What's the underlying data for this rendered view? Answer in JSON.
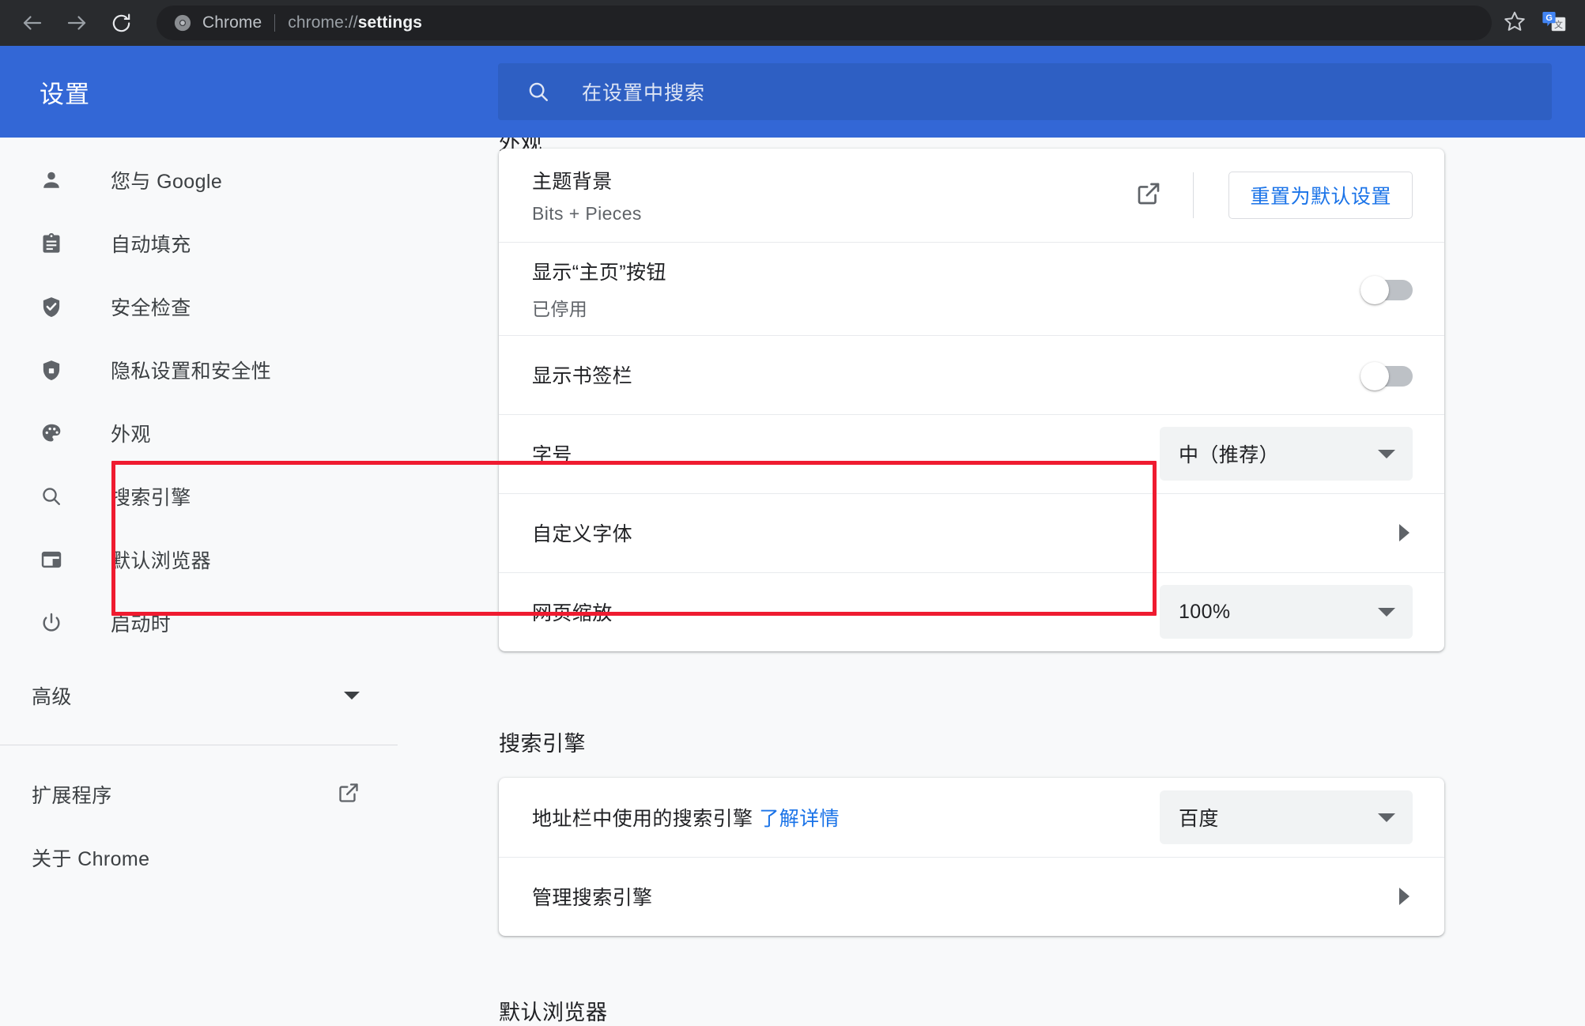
{
  "browser": {
    "back_icon": "back-arrow-icon",
    "forward_icon": "forward-arrow-icon",
    "reload_icon": "reload-icon",
    "omnibox": {
      "favicon": "chrome-logo-icon",
      "site_label": "Chrome",
      "url_prefix": "chrome://",
      "url_bold": "settings",
      "full_url": "chrome://settings"
    },
    "bookmark_icon": "star-outline-icon",
    "translate_icon": "google-translate-icon"
  },
  "settings_header": {
    "title": "设置",
    "search_icon": "search-icon",
    "search_placeholder": "在设置中搜索",
    "search_value": "",
    "accent_color": "#3367d6"
  },
  "sidebar": {
    "items": [
      {
        "label": "您与 Google",
        "icon": "person-icon"
      },
      {
        "label": "自动填充",
        "icon": "clipboard-icon"
      },
      {
        "label": "安全检查",
        "icon": "shield-check-icon"
      },
      {
        "label": "隐私设置和安全性",
        "icon": "shield-icon"
      },
      {
        "label": "外观",
        "icon": "palette-icon"
      },
      {
        "label": "搜索引擎",
        "icon": "search-icon"
      },
      {
        "label": "默认浏览器",
        "icon": "browser-window-icon"
      },
      {
        "label": "启动时",
        "icon": "power-icon"
      }
    ],
    "advanced": {
      "label": "高级",
      "icon": "chevron-down-icon"
    },
    "footer": [
      {
        "label": "扩展程序",
        "icon": "external-link-icon"
      },
      {
        "label": "关于 Chrome",
        "icon": ""
      }
    ]
  },
  "main": {
    "appearance": {
      "section_title": "外观",
      "theme": {
        "label": "主题背景",
        "value": "Bits + Pieces",
        "open_icon": "external-link-icon",
        "reset_label": "重置为默认设置"
      },
      "home_button": {
        "label": "显示“主页”按钮",
        "status": "已停用",
        "toggle_state": "off"
      },
      "bookmarks_bar": {
        "label": "显示书签栏",
        "toggle_state": "off"
      },
      "font_size": {
        "label": "字号",
        "value": "中（推荐）"
      },
      "custom_fonts": {
        "label": "自定义字体",
        "icon": "chevron-right-icon"
      },
      "page_zoom": {
        "label": "网页缩放",
        "value": "100%"
      }
    },
    "search_engine": {
      "section_title": "搜索引擎",
      "address_bar": {
        "label": "地址栏中使用的搜索引擎",
        "link_label": "了解详情",
        "value": "百度"
      },
      "manage": {
        "label": "管理搜索引擎",
        "icon": "chevron-right-icon"
      }
    },
    "default_browser": {
      "section_title": "默认浏览器"
    }
  },
  "annotation": {
    "highlight_color": "#ef1b30",
    "highlight_target": "font-size-and-custom-fonts-rows"
  }
}
